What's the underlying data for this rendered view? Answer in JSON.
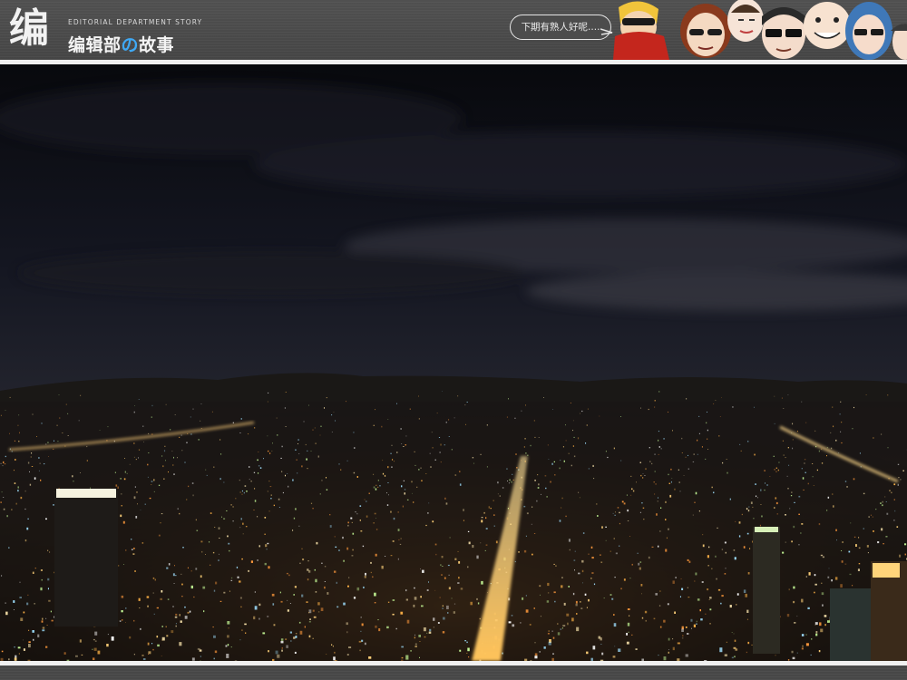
{
  "header": {
    "logo_glyph": "编",
    "subtitle": "EDITORIAL DEPARTMENT STORY",
    "title_part1": "编辑部",
    "title_accent": "の",
    "title_part2": "故事",
    "bubble_text": "下期有熟人好呢....",
    "faces": [
      "character-red-scarf",
      "character-sunglasses-woman",
      "character-pale",
      "character-sunglasses-man",
      "character-bald",
      "character-blue-hair",
      "character-edge"
    ]
  },
  "photo": {
    "subject": "night-city-skyline",
    "colors": {
      "sky_top": "#0b0e15",
      "sky_haze": "#2a2b36",
      "city_glow": "#f6a43a",
      "street": "#ffd27a"
    }
  }
}
